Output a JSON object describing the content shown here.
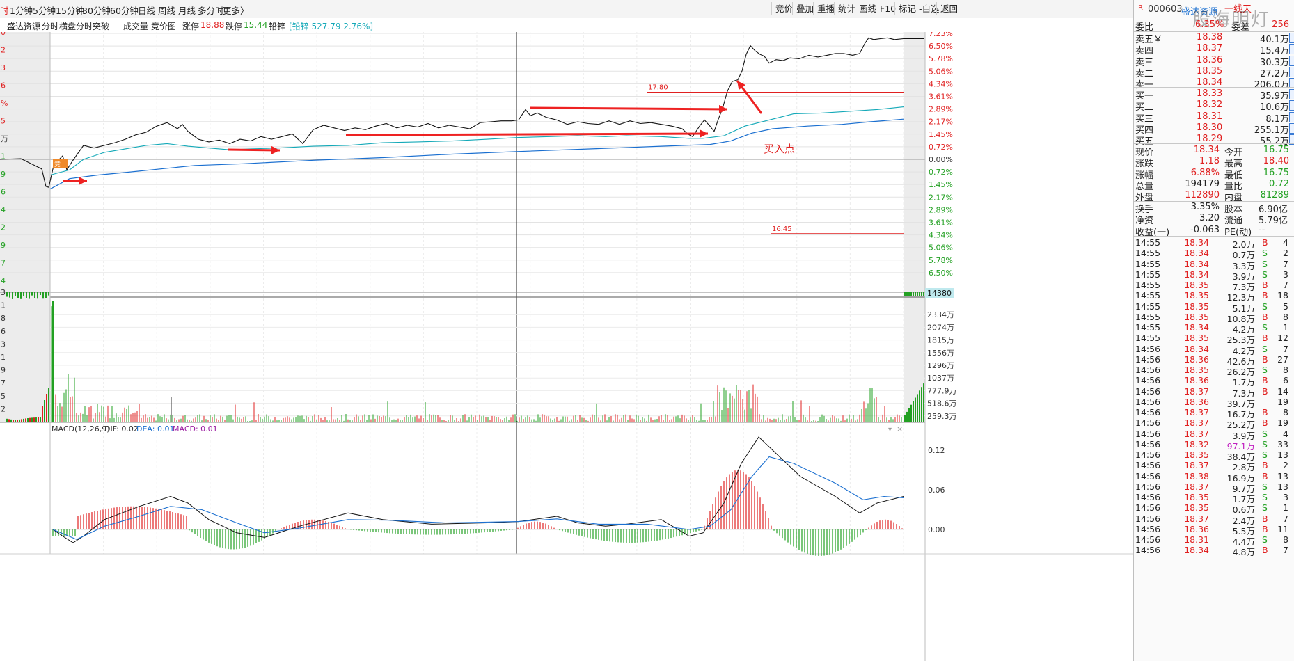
{
  "colors": {
    "up": "#e02020",
    "down": "#22a022",
    "avg": "#14a9b8",
    "ma": "#1a6fd0",
    "macd_dea": "#1a6fd0",
    "macd_label": "#9a1aa0"
  },
  "topbar": {
    "period_tabs": [
      "时",
      "1分钟",
      "5分钟",
      "15分钟",
      "30分钟",
      "60分钟",
      "日线",
      "周线",
      "月线",
      "多分时",
      "更多〉"
    ],
    "right_buttons": [
      "竞价",
      "叠加",
      "重播",
      "统计",
      "画线",
      "F10",
      "标记",
      "-自选",
      "返回"
    ]
  },
  "infobar": {
    "stock_name": "盛达资源",
    "tags": [
      "分时",
      "横盘分时突破",
      "成交量",
      "竞价图"
    ],
    "limit_up_label": "涨停",
    "limit_up_value": "18.88",
    "limit_down_label": "跌停",
    "limit_down_value": "15.44",
    "sector_label": "铅锌",
    "sector_value": "[铅锌 527.79 2.76%]"
  },
  "price_chart": {
    "left_axis_partial": [
      "0",
      "2",
      "3",
      "6",
      "%",
      "5",
      "万",
      "1",
      "9",
      "6",
      "4",
      "2",
      "9",
      "7",
      "4"
    ],
    "pct_labels_up": [
      "7.23%",
      "6.50%",
      "5.78%",
      "5.06%",
      "4.34%",
      "3.61%",
      "2.89%",
      "2.17%",
      "1.45%",
      "0.72%"
    ],
    "pct_zero": "0.00%",
    "pct_labels_down": [
      "0.72%",
      "1.45%",
      "2.17%",
      "2.89%",
      "3.61%",
      "4.34%",
      "5.06%",
      "5.78%",
      "6.50%"
    ],
    "hline_upper_label": "17.80",
    "hline_lower_label": "16.45",
    "annotation_buy": "买入点",
    "open_marker": "竞"
  },
  "volume_chart": {
    "left_axis_partial": [
      "3",
      "1",
      "8",
      "6",
      "3",
      "1",
      "9",
      "7",
      "5",
      "2"
    ],
    "current_label": "14380",
    "labels": [
      "2334万",
      "2074万",
      "1815万",
      "1556万",
      "1296万",
      "1037万",
      "777.9万",
      "518.6万",
      "259.3万"
    ]
  },
  "macd_chart": {
    "title": "MACD(12,26,9)",
    "dif_label": "DIF: 0.02",
    "dea_label": "DEA: 0.01",
    "macd_label": "MACD: 0.01",
    "labels": [
      "0.12",
      "0.06",
      "0.00"
    ]
  },
  "right_panel": {
    "header_flag": "R",
    "code": "000603",
    "name": "盛达资源",
    "tag": "一线天",
    "watermark": "股海明灯",
    "ratio": {
      "label": "委比",
      "value": "6.35%",
      "diff_label": "委差",
      "diff_value": "256"
    },
    "sells": [
      {
        "label": "卖五￥",
        "price": "18.38",
        "vol": "40.1万"
      },
      {
        "label": "卖四",
        "price": "18.37",
        "vol": "15.4万"
      },
      {
        "label": "卖三",
        "price": "18.36",
        "vol": "30.3万"
      },
      {
        "label": "卖二",
        "price": "18.35",
        "vol": "27.2万"
      },
      {
        "label": "卖一",
        "price": "18.34",
        "vol": "206.0万"
      }
    ],
    "buys": [
      {
        "label": "买一",
        "price": "18.33",
        "vol": "35.9万"
      },
      {
        "label": "买二",
        "price": "18.32",
        "vol": "10.6万"
      },
      {
        "label": "买三",
        "price": "18.31",
        "vol": "8.1万"
      },
      {
        "label": "买四",
        "price": "18.30",
        "vol": "255.1万"
      },
      {
        "label": "买五",
        "price": "18.29",
        "vol": "55.2万"
      }
    ],
    "stats": [
      {
        "l1": "现价",
        "v1": "18.34",
        "c1": "up",
        "l2": "今开",
        "v2": "16.75",
        "c2": "down"
      },
      {
        "l1": "涨跌",
        "v1": "1.18",
        "c1": "up",
        "l2": "最高",
        "v2": "18.40",
        "c2": "up"
      },
      {
        "l1": "涨幅",
        "v1": "6.88%",
        "c1": "up",
        "l2": "最低",
        "v2": "16.75",
        "c2": "down"
      },
      {
        "l1": "总量",
        "v1": "194179",
        "c1": "plain",
        "l2": "量比",
        "v2": "0.72",
        "c2": "down"
      },
      {
        "l1": "外盘",
        "v1": "112890",
        "c1": "up",
        "l2": "内盘",
        "v2": "81289",
        "c2": "down"
      }
    ],
    "stats2": [
      {
        "l1": "换手",
        "v1": "3.35%",
        "l2": "股本",
        "v2": "6.90亿"
      },
      {
        "l1": "净资",
        "v1": "3.20",
        "l2": "流通",
        "v2": "5.79亿"
      },
      {
        "l1": "收益(一)",
        "v1": "-0.063",
        "l2": "PE(动)",
        "v2": "--"
      }
    ],
    "ticks": [
      {
        "t": "14:55",
        "p": "18.34",
        "v": "2.0万",
        "d": "B",
        "n": "4"
      },
      {
        "t": "14:55",
        "p": "18.34",
        "v": "0.7万",
        "d": "S",
        "n": "2"
      },
      {
        "t": "14:55",
        "p": "18.34",
        "v": "3.3万",
        "d": "S",
        "n": "7"
      },
      {
        "t": "14:55",
        "p": "18.34",
        "v": "3.9万",
        "d": "S",
        "n": "3"
      },
      {
        "t": "14:55",
        "p": "18.35",
        "v": "7.3万",
        "d": "B",
        "n": "7"
      },
      {
        "t": "14:55",
        "p": "18.35",
        "v": "12.3万",
        "d": "B",
        "n": "18"
      },
      {
        "t": "14:55",
        "p": "18.35",
        "v": "5.1万",
        "d": "S",
        "n": "5"
      },
      {
        "t": "14:55",
        "p": "18.35",
        "v": "10.8万",
        "d": "B",
        "n": "8"
      },
      {
        "t": "14:55",
        "p": "18.34",
        "v": "4.2万",
        "d": "S",
        "n": "1"
      },
      {
        "t": "14:55",
        "p": "18.35",
        "v": "25.3万",
        "d": "B",
        "n": "12"
      },
      {
        "t": "14:56",
        "p": "18.34",
        "v": "4.2万",
        "d": "S",
        "n": "7"
      },
      {
        "t": "14:56",
        "p": "18.36",
        "v": "42.6万",
        "d": "B",
        "n": "27"
      },
      {
        "t": "14:56",
        "p": "18.35",
        "v": "26.2万",
        "d": "S",
        "n": "8"
      },
      {
        "t": "14:56",
        "p": "18.36",
        "v": "1.7万",
        "d": "B",
        "n": "6"
      },
      {
        "t": "14:56",
        "p": "18.37",
        "v": "7.3万",
        "d": "B",
        "n": "14"
      },
      {
        "t": "14:56",
        "p": "18.36",
        "v": "39.7万",
        "d": "",
        "n": "19"
      },
      {
        "t": "14:56",
        "p": "18.37",
        "v": "16.7万",
        "d": "B",
        "n": "8"
      },
      {
        "t": "14:56",
        "p": "18.37",
        "v": "25.2万",
        "d": "B",
        "n": "19"
      },
      {
        "t": "14:56",
        "p": "18.37",
        "v": "3.9万",
        "d": "S",
        "n": "4"
      },
      {
        "t": "14:56",
        "p": "18.32",
        "v": "97.1万",
        "d": "S",
        "n": "33"
      },
      {
        "t": "14:56",
        "p": "18.35",
        "v": "38.4万",
        "d": "S",
        "n": "13"
      },
      {
        "t": "14:56",
        "p": "18.37",
        "v": "2.8万",
        "d": "B",
        "n": "2"
      },
      {
        "t": "14:56",
        "p": "18.38",
        "v": "16.9万",
        "d": "B",
        "n": "13"
      },
      {
        "t": "14:56",
        "p": "18.37",
        "v": "9.7万",
        "d": "S",
        "n": "13"
      },
      {
        "t": "14:56",
        "p": "18.35",
        "v": "1.7万",
        "d": "S",
        "n": "3"
      },
      {
        "t": "14:56",
        "p": "18.35",
        "v": "0.6万",
        "d": "S",
        "n": "1"
      },
      {
        "t": "14:56",
        "p": "18.37",
        "v": "2.4万",
        "d": "B",
        "n": "7"
      },
      {
        "t": "14:56",
        "p": "18.36",
        "v": "5.5万",
        "d": "B",
        "n": "11"
      },
      {
        "t": "14:56",
        "p": "18.31",
        "v": "4.4万",
        "d": "S",
        "n": "8"
      },
      {
        "t": "14:56",
        "p": "18.34",
        "v": "4.8万",
        "d": "B",
        "n": "7"
      }
    ]
  }
}
